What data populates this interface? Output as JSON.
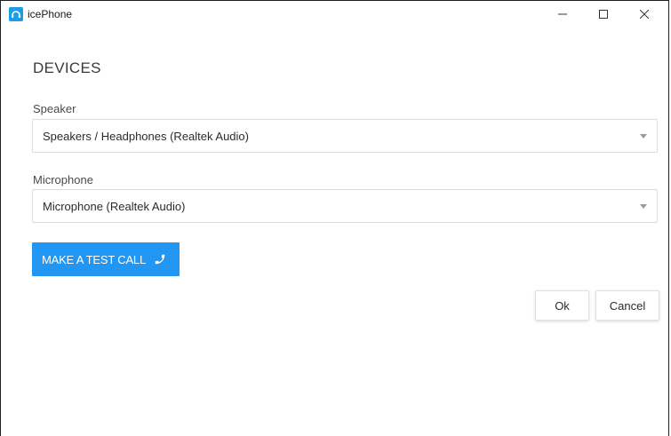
{
  "window": {
    "title": "icePhone",
    "minimize_icon": "minimize-icon",
    "maximize_icon": "maximize-icon",
    "close_icon": "close-icon"
  },
  "page": {
    "heading": "DEVICES"
  },
  "speaker": {
    "label": "Speaker",
    "selected": "Speakers / Headphones (Realtek Audio)"
  },
  "microphone": {
    "label": "Microphone",
    "selected": "Microphone (Realtek Audio)"
  },
  "test_call": {
    "label": "MAKE A TEST CALL",
    "icon": "phone-icon"
  },
  "buttons": {
    "ok": "Ok",
    "cancel": "Cancel"
  },
  "colors": {
    "accent": "#2196f3",
    "app_icon": "#1e9be8"
  }
}
